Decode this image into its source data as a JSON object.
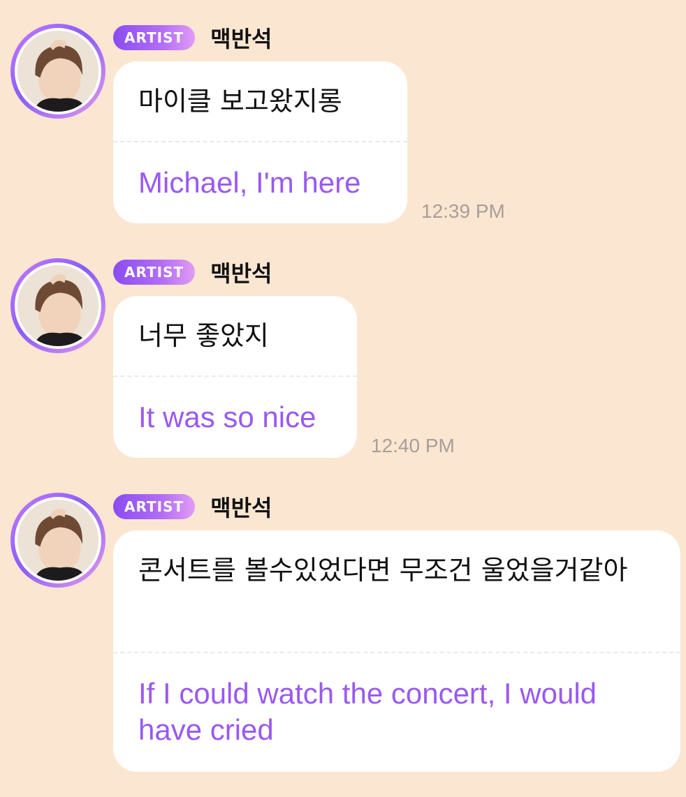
{
  "colors": {
    "background": "#fbe6d1",
    "bubble": "#ffffff",
    "translation_text": "#9a59f0",
    "badge_gradient_start": "#8a4cf0",
    "badge_gradient_end": "#e29bf5",
    "timestamp": "#a79f9a"
  },
  "messages": [
    {
      "badge": "ARTIST",
      "sender": "맥반석",
      "original": "마이클 보고왔지롱",
      "translation": "Michael, I'm here",
      "time": "12:39 PM",
      "avatar_icon": "artist-profile-photo"
    },
    {
      "badge": "ARTIST",
      "sender": "맥반석",
      "original": "너무 좋았지",
      "translation": "It was so nice",
      "time": "12:40 PM",
      "avatar_icon": "artist-profile-photo"
    },
    {
      "badge": "ARTIST",
      "sender": "맥반석",
      "original": "콘서트를 볼수있었다면 무조건 울었을거같아",
      "translation": "If I could watch the concert, I would have cried",
      "time": "",
      "avatar_icon": "artist-profile-photo"
    }
  ]
}
